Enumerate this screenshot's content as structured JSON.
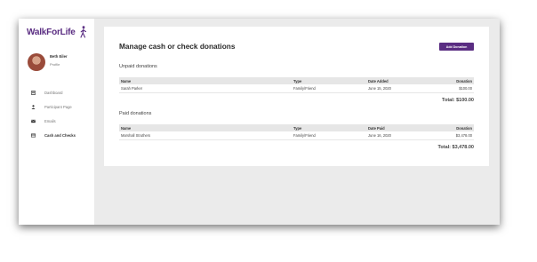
{
  "sidebar": {
    "logo": "WalkForLife",
    "user_name": "Beth Eiler",
    "user_sub": "Profile",
    "items": [
      {
        "label": "Dashboard",
        "icon": "dashboard-icon"
      },
      {
        "label": "Participant Page",
        "icon": "person-icon"
      },
      {
        "label": "Emails",
        "icon": "email-icon"
      },
      {
        "label": "Cash and Checks",
        "icon": "card-icon"
      }
    ]
  },
  "main": {
    "title": "Manage cash or check donations",
    "add_button": "Add Donation",
    "unpaid": {
      "title": "Unpaid donations",
      "columns": [
        "Name",
        "Type",
        "Date Added",
        "Donation"
      ],
      "rows": [
        [
          "Sarah Parker",
          "Family/Friend",
          "June 15, 2020",
          "$100.00"
        ]
      ],
      "total": "Total: $100.00"
    },
    "paid": {
      "title": "Paid donations",
      "columns": [
        "Name",
        "Type",
        "Date Paid",
        "Donation"
      ],
      "rows": [
        [
          "Marshall Struthers",
          "Family/Friend",
          "June 16, 2020",
          "$3,478.00"
        ]
      ],
      "total": "Total: $3,478.00"
    }
  },
  "colors": {
    "accent": "#5a2d82",
    "background": "#ebebeb"
  }
}
